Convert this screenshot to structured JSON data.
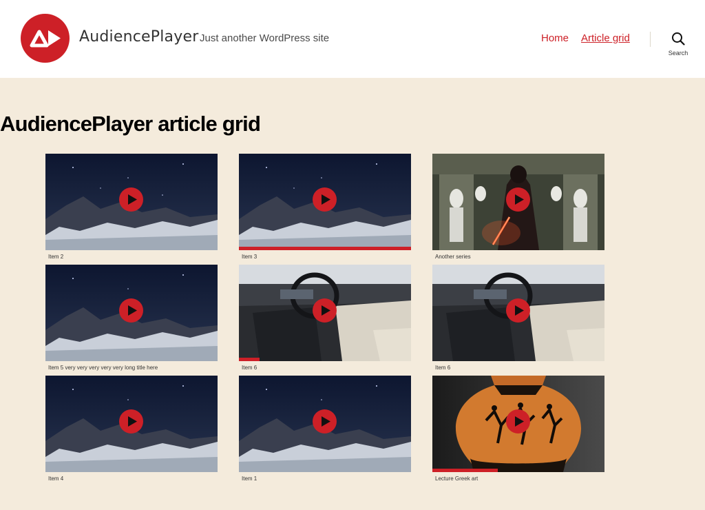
{
  "site": {
    "brand_name": "AudiencePlayer",
    "tagline": "Just another WordPress site"
  },
  "nav": {
    "items": [
      {
        "label": "Home",
        "active": false
      },
      {
        "label": "Article grid",
        "active": true
      }
    ],
    "search_label": "Search"
  },
  "page": {
    "title": "AudiencePlayer article grid"
  },
  "grid": {
    "items": [
      {
        "title": "Item 2",
        "image": "night-forest",
        "progress": 0
      },
      {
        "title": "Item 3",
        "image": "night-forest",
        "progress": 1.0
      },
      {
        "title": "Another series",
        "image": "sci-fi-villain",
        "progress": 0
      },
      {
        "title": "Item 5 very very very very very long title here",
        "image": "night-forest",
        "progress": 0
      },
      {
        "title": "Item 6",
        "image": "car-interior",
        "progress": 0.12
      },
      {
        "title": "Item 6",
        "image": "car-interior",
        "progress": 0
      },
      {
        "title": "Item 4",
        "image": "night-forest",
        "progress": 0
      },
      {
        "title": "Item 1",
        "image": "night-forest",
        "progress": 0
      },
      {
        "title": "Lecture Greek art",
        "image": "greek-vase",
        "progress": 0.38
      }
    ]
  },
  "colors": {
    "accent": "#cd2027",
    "background": "#f4ebdc",
    "header_bg": "#ffffff"
  },
  "icons": {
    "logo": "audienceplayer-logo-icon",
    "search": "search-icon",
    "play": "play-icon"
  }
}
